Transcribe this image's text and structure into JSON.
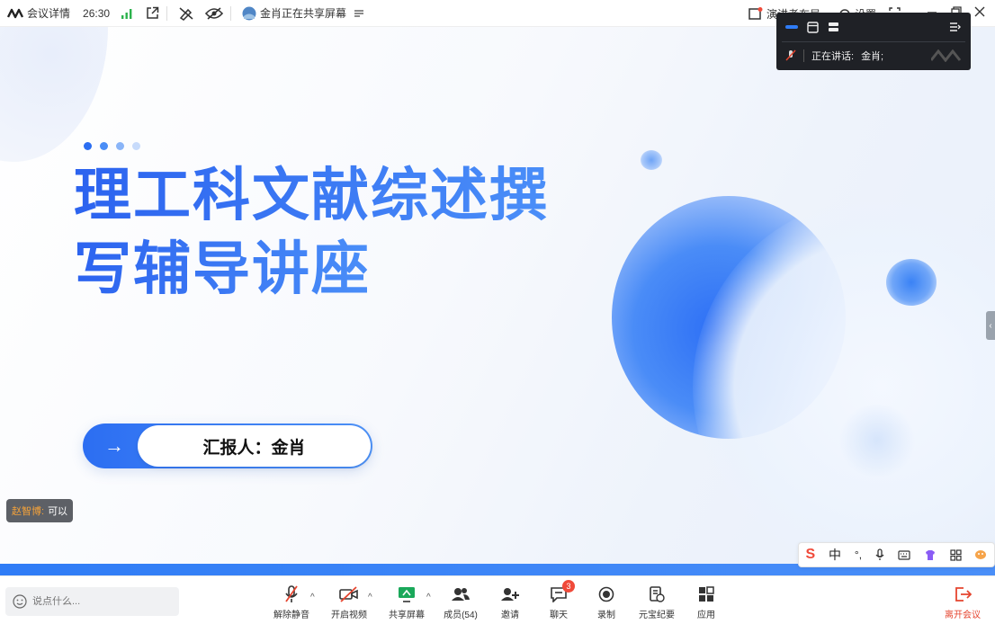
{
  "topbar": {
    "meeting_details": "会议详情",
    "timer": "26:30",
    "sharer_status": "金肖正在共享屏幕",
    "presenter_layout": "演讲者布局",
    "settings": "设置"
  },
  "speaker_window": {
    "speaking_label": "正在讲话:",
    "speaker_name": "金肖;"
  },
  "slide": {
    "title_line1": "理工科文献综述撰",
    "title_line2": "写辅导讲座",
    "reporter": "汇报人：金肖",
    "arrow": "→",
    "dots": [
      "#2b6ef2",
      "#4a8df6",
      "#8ab5f8",
      "#c7dbfb"
    ],
    "accent": "#2f6ff0"
  },
  "chat_toast": {
    "sender": "赵智博:",
    "message": "可以"
  },
  "ime": {
    "mode": "中"
  },
  "bottombar": {
    "input_placeholder": "说点什么...",
    "unmute": "解除静音",
    "start_video": "开启视频",
    "share_screen": "共享屏幕",
    "members": "成员(54)",
    "invite": "邀请",
    "chat": "聊天",
    "chat_badge": "3",
    "record": "录制",
    "yuanbao_minutes": "元宝纪要",
    "apps": "应用",
    "leave": "离开会议",
    "leave_color": "#e5452f"
  }
}
